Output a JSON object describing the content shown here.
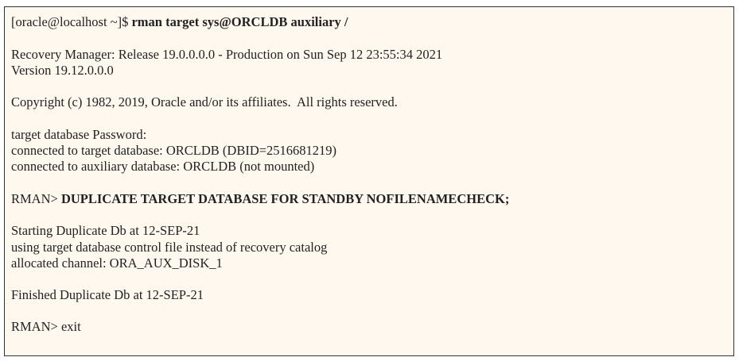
{
  "terminal": {
    "prompt": "[oracle@localhost ~]$ ",
    "command": "rman target sys@ORCLDB auxiliary /",
    "banner1": "Recovery Manager: Release 19.0.0.0.0 - Production on Sun Sep 12 23:55:34 2021",
    "banner2": "Version 19.12.0.0.0",
    "copyright": "Copyright (c) 1982, 2019, Oracle and/or its affiliates.  All rights reserved.",
    "password": "target database Password:",
    "connected_target": "connected to target database: ORCLDB (DBID=2516681219)",
    "connected_aux": "connected to auxiliary database: ORCLDB (not mounted)",
    "rman_prompt": "RMAN> ",
    "duplicate_cmd": "DUPLICATE TARGET DATABASE FOR STANDBY NOFILENAMECHECK;",
    "starting": "Starting Duplicate Db at 12-SEP-21",
    "using": "using target database control file instead of recovery catalog",
    "channel": "allocated channel: ORA_AUX_DISK_1",
    "finished": "Finished Duplicate Db at 12-SEP-21",
    "exit_cmd": "exit"
  }
}
